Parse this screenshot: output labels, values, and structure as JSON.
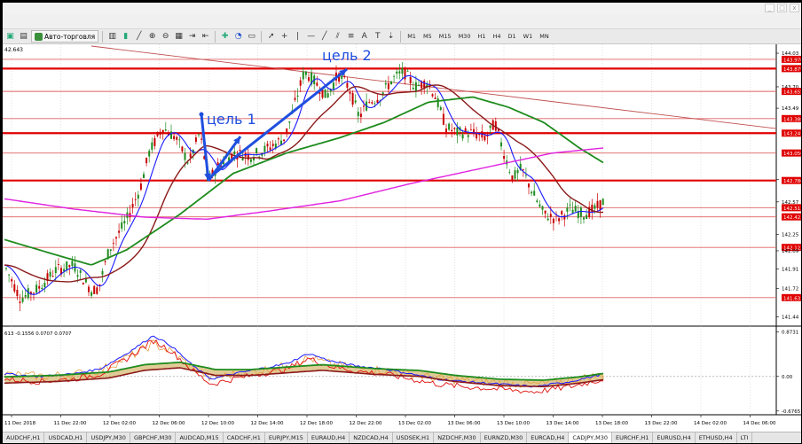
{
  "titlebar": {
    "faded_text": "",
    "window_buttons": [
      "_",
      "□",
      "x"
    ]
  },
  "toolbar": {
    "autotrade_label": "Авто-торговля",
    "timeframes": [
      "M1",
      "M5",
      "M15",
      "M30",
      "H1",
      "H4",
      "D1",
      "W1",
      "MN"
    ]
  },
  "chart": {
    "symbol_label": "42.643",
    "annotations": {
      "target1": "цель 1",
      "target2": "цель 2"
    },
    "price_axis": [
      {
        "label": "144.03",
        "y": 144.03,
        "tag": false
      },
      {
        "label": "143.970",
        "y": 143.97,
        "tag": true
      },
      {
        "label": "143.879",
        "y": 143.879,
        "tag": true
      },
      {
        "label": "143.70",
        "y": 143.7,
        "tag": false
      },
      {
        "label": "143.655",
        "y": 143.655,
        "tag": true
      },
      {
        "label": "143.49",
        "y": 143.49,
        "tag": false
      },
      {
        "label": "143.388",
        "y": 143.388,
        "tag": true
      },
      {
        "label": "143.245",
        "y": 143.245,
        "tag": true
      },
      {
        "label": "143.050",
        "y": 143.05,
        "tag": true
      },
      {
        "label": "142.79",
        "y": 142.79,
        "tag": false
      },
      {
        "label": "142.780",
        "y": 142.78,
        "tag": true
      },
      {
        "label": "142.57",
        "y": 142.57,
        "tag": false
      },
      {
        "label": "142.513",
        "y": 142.513,
        "tag": true
      },
      {
        "label": "142.423",
        "y": 142.423,
        "tag": true
      },
      {
        "label": "142.25",
        "y": 142.25,
        "tag": false
      },
      {
        "label": "142.123",
        "y": 142.123,
        "tag": true
      },
      {
        "label": "142.09",
        "y": 142.09,
        "tag": false
      },
      {
        "label": "141.91",
        "y": 141.91,
        "tag": false
      },
      {
        "label": "141.72",
        "y": 141.72,
        "tag": false
      },
      {
        "label": "141.63",
        "y": 141.63,
        "tag": true
      },
      {
        "label": "141.44",
        "y": 141.44,
        "tag": false
      }
    ],
    "horizontal_levels": [
      {
        "price": 143.879,
        "color": "#e00000",
        "thick": true
      },
      {
        "price": 143.655,
        "color": "#e06060",
        "thick": false
      },
      {
        "price": 143.388,
        "color": "#e06060",
        "thick": false
      },
      {
        "price": 143.245,
        "color": "#e00000",
        "thick": true
      },
      {
        "price": 143.05,
        "color": "#e06060",
        "thick": false
      },
      {
        "price": 142.78,
        "color": "#e00000",
        "thick": true
      },
      {
        "price": 142.513,
        "color": "#e06060",
        "thick": false
      },
      {
        "price": 142.423,
        "color": "#e06060",
        "thick": false
      },
      {
        "price": 142.123,
        "color": "#e06060",
        "thick": false
      },
      {
        "price": 141.63,
        "color": "#e06060",
        "thick": false
      },
      {
        "price": 143.97,
        "color": "#e06060",
        "thick": false
      }
    ],
    "price_range": [
      141.35,
      144.1
    ],
    "colors": {
      "level": "#e00000",
      "arrow": "#1f4fe0",
      "ma_blue": "#1a1aff",
      "ma_brown": "#8b1a1a",
      "ma_green": "#1e8c1e",
      "ma_magenta": "#e020e0",
      "candle_up": "#1e8c1e",
      "candle_down": "#c80000",
      "band_fill": "#c8a040"
    }
  },
  "indicator": {
    "label": "613 -0.1556 0.0707 0.0707",
    "axis": [
      {
        "label": "0.8731",
        "v": 0.8731
      },
      {
        "label": "0.00",
        "v": 0.0
      },
      {
        "label": "-0.6765",
        "v": -0.6765
      }
    ],
    "range": [
      -0.75,
      0.95
    ]
  },
  "time_axis": [
    "11 Dec 2018",
    "11 Dec 22:00",
    "12 Dec 02:00",
    "12 Dec 06:00",
    "12 Dec 10:00",
    "12 Dec 14:00",
    "12 Dec 18:00",
    "12 Dec 22:00",
    "13 Dec 02:00",
    "13 Dec 06:00",
    "13 Dec 10:00",
    "13 Dec 14:00",
    "13 Dec 18:00",
    "13 Dec 22:00",
    "14 Dec 02:00",
    "14 Dec 06:00",
    "14 Dec 10:00",
    "14 Dec 14:00",
    "14 Dec 18:00"
  ],
  "tabs": [
    {
      "label": "AUDCHF,H1",
      "active": false
    },
    {
      "label": "USDCAD,H1",
      "active": false
    },
    {
      "label": "USDJPY,M30",
      "active": false
    },
    {
      "label": "GBPCHF,M30",
      "active": false
    },
    {
      "label": "AUDCAD,M15",
      "active": false
    },
    {
      "label": "CADCHF,H1",
      "active": false
    },
    {
      "label": "EURJPY,M15",
      "active": false
    },
    {
      "label": "EURAUD,H4",
      "active": false
    },
    {
      "label": "NZDCAD,H4",
      "active": false
    },
    {
      "label": "USDSEK,H1",
      "active": false
    },
    {
      "label": "NZDCHF,M30",
      "active": false
    },
    {
      "label": "EURNZD,M30",
      "active": false
    },
    {
      "label": "EURCAD,H4",
      "active": false
    },
    {
      "label": "CADJPY,M30",
      "active": true
    },
    {
      "label": "EURCHF,H1",
      "active": false
    },
    {
      "label": "EURUSD,H4",
      "active": false
    },
    {
      "label": "ETHUSD,H4",
      "active": false
    },
    {
      "label": "LTI",
      "active": false
    }
  ]
}
